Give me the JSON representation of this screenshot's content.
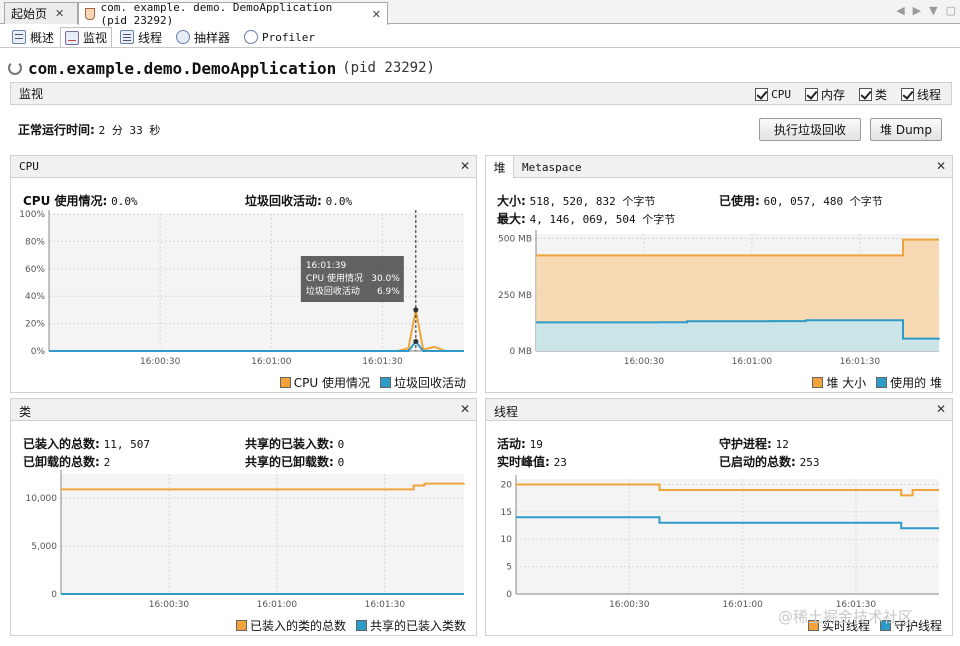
{
  "tabs": {
    "start_label": "起始页",
    "app_label": "com. example. demo. DemoApplication (pid 23292)",
    "close": "✕"
  },
  "subtabs": [
    "概述",
    "监视",
    "线程",
    "抽样器",
    "Profiler"
  ],
  "title": {
    "main": "com.example.demo.DemoApplication",
    "pid": "(pid 23292)"
  },
  "monitor": {
    "label": "监视",
    "checks": [
      "CPU",
      "内存",
      "类",
      "线程"
    ]
  },
  "uptime": {
    "label": "正常运行时间:",
    "value": "2 分 33 秒"
  },
  "buttons": {
    "gc": "执行垃圾回收",
    "dump": "堆 Dump"
  },
  "colors": {
    "orange": "#f0a33a",
    "blue": "#2e9ac8",
    "orange_fill": "#f7d3a4",
    "blue_fill": "#bfe6f5"
  },
  "cpu_panel": {
    "title": "CPU",
    "usage_label": "CPU 使用情况:",
    "usage_value": "0.0%",
    "gc_label": "垃圾回收活动:",
    "gc_value": "0.0%",
    "tooltip": {
      "time": "16:01:39",
      "cpu_label": "CPU 使用情况",
      "cpu_value": "30.0%",
      "gc_label": "垃圾回收活动",
      "gc_value": "6.9%"
    },
    "legend": [
      "CPU 使用情况",
      "垃圾回收活动"
    ]
  },
  "heap_panel": {
    "tab_heap": "堆",
    "tab_meta": "Metaspace",
    "size_label": "大小:",
    "size_value": "518, 520, 832 个字节",
    "used_label": "已使用:",
    "used_value": "60, 057, 480 个字节",
    "max_label": "最大:",
    "max_value": "4, 146, 069, 504 个字节",
    "legend": [
      "堆 大小",
      "使用的 堆"
    ]
  },
  "classes_panel": {
    "title": "类",
    "loaded_label": "已装入的总数:",
    "loaded_value": "11, 507",
    "unloaded_label": "已卸载的总数:",
    "unloaded_value": "2",
    "shared_loaded_label": "共享的已装入数:",
    "shared_loaded_value": "0",
    "shared_unloaded_label": "共享的已卸载数:",
    "shared_unloaded_value": "0",
    "legend": [
      "已装入的类的总数",
      "共享的已装入类数"
    ]
  },
  "threads_panel": {
    "title": "线程",
    "live_label": "活动:",
    "live_value": "19",
    "peak_label": "实时峰值:",
    "peak_value": "23",
    "daemon_label": "守护进程:",
    "daemon_value": "12",
    "started_label": "已启动的总数:",
    "started_value": "253",
    "legend": [
      "实时线程",
      "守护线程"
    ]
  },
  "watermark": "@稀土掘金技术社区",
  "chart_data": [
    {
      "type": "line",
      "title": "CPU",
      "x_ticks": [
        "16:00:30",
        "16:01:00",
        "16:01:30"
      ],
      "y_ticks": [
        "0%",
        "20%",
        "40%",
        "60%",
        "80%",
        "100%"
      ],
      "ylim": [
        0,
        100
      ],
      "x": [
        "16:00:00",
        "16:01:34",
        "16:01:37",
        "16:01:39",
        "16:01:41",
        "16:01:44",
        "16:01:47",
        "16:01:52"
      ],
      "series": [
        {
          "name": "CPU 使用情况",
          "values": [
            0,
            0,
            2,
            30,
            1,
            3,
            0,
            0
          ]
        },
        {
          "name": "垃圾回收活动",
          "values": [
            0,
            0,
            0,
            6.9,
            0,
            0,
            0,
            0
          ]
        }
      ],
      "grid": true
    },
    {
      "type": "area",
      "title": "堆",
      "x_ticks": [
        "16:00:30",
        "16:01:00",
        "16:01:30"
      ],
      "y_ticks": [
        "0 MB",
        "250 MB",
        "500 MB"
      ],
      "ylim": [
        0,
        520
      ],
      "x": [
        "16:00:00",
        "16:00:34",
        "16:00:42",
        "16:01:05",
        "16:01:15",
        "16:01:40",
        "16:01:42",
        "16:01:52"
      ],
      "series": [
        {
          "name": "堆 大小",
          "values": [
            425,
            425,
            425,
            425,
            425,
            425,
            495,
            495
          ]
        },
        {
          "name": "使用的 堆",
          "values": [
            127,
            128,
            132,
            133,
            137,
            137,
            55,
            57
          ]
        }
      ],
      "grid": true
    },
    {
      "type": "line",
      "title": "类",
      "x_ticks": [
        "16:00:30",
        "16:01:00",
        "16:01:30"
      ],
      "y_ticks": [
        "0",
        "5,000",
        "10,000"
      ],
      "ylim": [
        0,
        12500
      ],
      "x": [
        "16:00:00",
        "16:01:36",
        "16:01:38",
        "16:01:41",
        "16:01:52"
      ],
      "series": [
        {
          "name": "已装入的类的总数",
          "values": [
            10900,
            10900,
            11300,
            11500,
            11507
          ]
        },
        {
          "name": "共享的已装入类数",
          "values": [
            0,
            0,
            0,
            0,
            0
          ]
        }
      ],
      "grid": true
    },
    {
      "type": "line",
      "title": "线程",
      "x_ticks": [
        "16:00:30",
        "16:01:00",
        "16:01:30"
      ],
      "y_ticks": [
        "0",
        "5",
        "10",
        "15",
        "20"
      ],
      "ylim": [
        0,
        21
      ],
      "x": [
        "16:00:00",
        "16:00:37",
        "16:00:38",
        "16:01:41",
        "16:01:42",
        "16:01:44",
        "16:01:45",
        "16:01:52"
      ],
      "series": [
        {
          "name": "实时线程",
          "values": [
            20,
            20,
            19,
            19,
            18,
            18,
            19,
            19
          ]
        },
        {
          "name": "守护线程",
          "values": [
            14,
            14,
            13,
            13,
            12,
            12,
            12,
            12
          ]
        }
      ],
      "grid": true
    }
  ]
}
